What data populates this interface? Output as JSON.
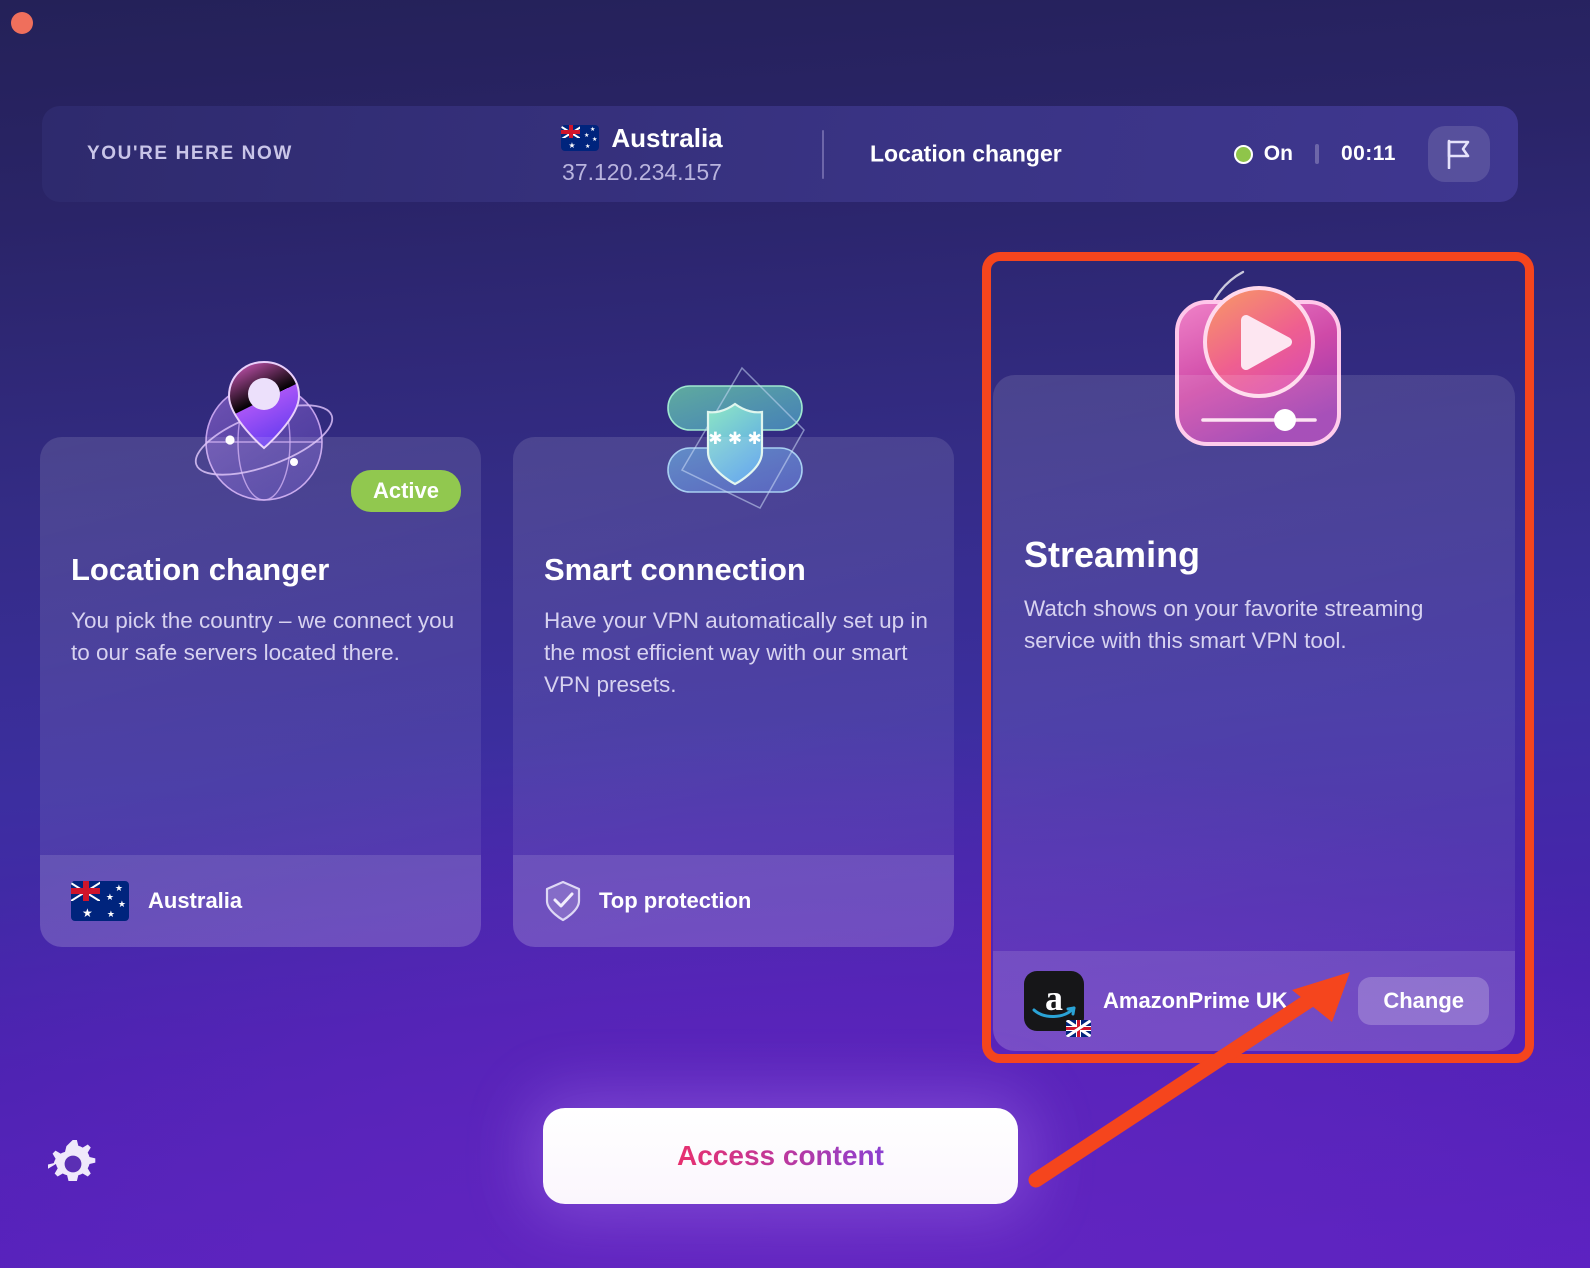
{
  "window": {
    "close_button": "close-button"
  },
  "statusbar": {
    "here_label": "YOU'RE HERE NOW",
    "country": "Australia",
    "country_flag": "au-flag-icon",
    "ip_address": "37.120.234.157",
    "mode": "Location changer",
    "state_label": "On",
    "state_color": "#8fc54a",
    "timer": "00:11",
    "flag_button_icon": "flag-icon"
  },
  "cards": [
    {
      "id": "location-changer",
      "icon": "globe-pin-icon",
      "badge": "Active",
      "badge_color": "#91c84f",
      "title": "Location changer",
      "description": "You pick the country – we connect you to our safe servers located there.",
      "footer_icon": "au-flag-icon",
      "footer_label": "Australia"
    },
    {
      "id": "smart-connection",
      "icon": "shield-layers-icon",
      "title": "Smart connection",
      "description": "Have your VPN automatically set up in the most efficient way with our smart VPN presets.",
      "footer_icon": "shield-check-icon",
      "footer_label": "Top protection"
    },
    {
      "id": "streaming",
      "icon": "video-play-icon",
      "title": "Streaming",
      "description": "Watch shows on your favorite streaming service with this smart VPN tool.",
      "footer_icon": "amazon-icon",
      "footer_label": "AmazonPrime UK",
      "action_label": "Change",
      "highlighted": true
    }
  ],
  "bottom": {
    "settings_icon": "gear-icon",
    "access_button": "Access content"
  },
  "annotations": {
    "highlight_color": "#f5451d",
    "arrow_target": "change-button"
  }
}
